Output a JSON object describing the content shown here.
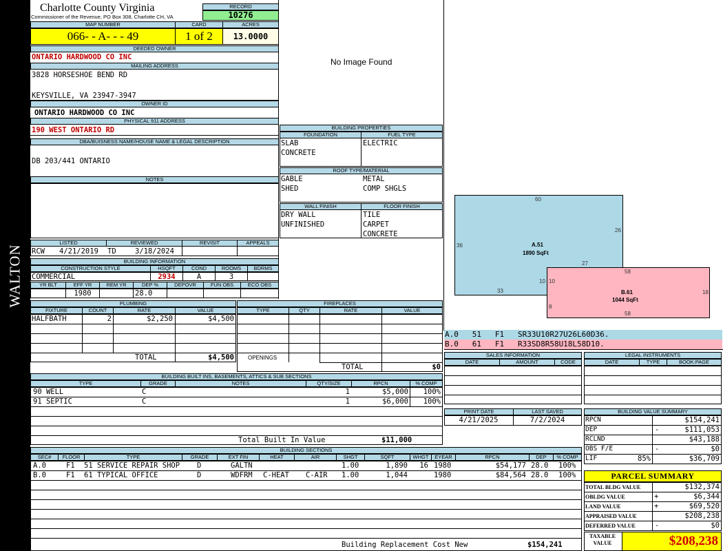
{
  "side_label": "WALTON",
  "header": {
    "county": "Charlotte County Virginia",
    "commissioner": "Commissioner of the Revenue, PO Box 308, Charlotte CH, VA",
    "record_label": "RECORD",
    "record": "10276",
    "map_label": "MAP NUMBER",
    "map_number": "066- - A- - - 49",
    "card_label": "CARD",
    "card": "1 of 2",
    "acres_label": "ACRES",
    "acres": "13.0000"
  },
  "owner": {
    "deeded_label": "DEEDED OWNER",
    "deeded": "ONTARIO HARDWOOD CO INC",
    "mailing_label": "MAILING ADDRESS",
    "mail1": "3828 HORSESHOE BEND RD",
    "mail2": "KEYSVILLE, VA 23947-3947",
    "ownerid_label": "OWNER ID",
    "ownerid": "ONTARIO HARDWOOD CO INC",
    "phys_label": "PHYSICAL 911 ADDRESS",
    "phys": "190 WEST ONTARIO RD",
    "dba_label": "DBA/BUISNESS NAME/HOUSE NAME & LEGAL DESCRIPTION",
    "dba": "DB 203/441 ONTARIO",
    "notes_label": "NOTES"
  },
  "image": {
    "text": "No Image Found"
  },
  "props": {
    "title": "BUILDING PROPERTIES",
    "foundation_label": "FOUNDATION",
    "foundation": [
      "SLAB",
      "CONCRETE"
    ],
    "fuel_label": "FUEL TYPE",
    "fuel": [
      "ELECTRIC"
    ],
    "roof_label": "ROOF TYPE/MATERIAL",
    "roof_left": [
      "GABLE",
      "SHED"
    ],
    "roof_right": [
      "METAL",
      "COMP SHGLS"
    ],
    "wall_label": "WALL FINISH",
    "wall": [
      "DRY WALL",
      "UNFINISHED"
    ],
    "floor_label": "FLOOR FINISH",
    "floor": [
      "TILE",
      "CARPET",
      "CONCRETE"
    ]
  },
  "review": {
    "listed_label": "LISTED",
    "listed_by": "RCW",
    "listed_date": "4/21/2019",
    "reviewed_label": "REVIEWED",
    "reviewed_by": "TD",
    "reviewed_date": "3/18/2024",
    "revisit_label": "REVISIT",
    "appeals_label": "APPEALS"
  },
  "bldg_info": {
    "title": "BUILDING INFORMATION",
    "style_label": "CONSTRUCTION STYLE",
    "style": "COMMERCIAL",
    "hsqft_label": "HSQFT",
    "hsqft": "2934",
    "cond_label": "COND",
    "cond": "A",
    "rooms_label": "ROOMS",
    "rooms": "3",
    "bdrms_label": "BDRMS",
    "yrblt_label": "YR BLT",
    "effyr_label": "EFF YR",
    "effyr": "1980",
    "remyr_label": "REM YR",
    "dep_label": "DEP %",
    "dep": "28.0",
    "depovr_label": "DEPOVR",
    "funobs_label": "FUN OBS",
    "ecoobs_label": "ECO OBS"
  },
  "plumbing": {
    "title": "PLUMBING",
    "cols": [
      "FIXTURE",
      "COUNT",
      "RATE",
      "VALUE"
    ],
    "rows": [
      {
        "fixture": "HALFBATH",
        "count": "2",
        "rate": "$2,250",
        "value": "$4,500"
      }
    ],
    "total_label": "TOTAL",
    "total": "$4,500"
  },
  "fireplaces": {
    "title": "FIREPLACES",
    "cols": [
      "TYPE",
      "QTY",
      "RATE",
      "VALUE"
    ],
    "openings_label": "OPENINGS",
    "total_label": "TOTAL",
    "total": "$0"
  },
  "builtins": {
    "title": "BUILDING BUILT INS, BASEMENTS, ATTICS & SUB SECTIONS",
    "cols": [
      "TYPE",
      "GRADE",
      "NOTES",
      "QTY/SIZE",
      "RPCN",
      "% COMP"
    ],
    "rows": [
      {
        "type": "90 WELL",
        "grade": "C",
        "qty": "1",
        "rpcn": "$5,000",
        "comp": "100%"
      },
      {
        "type": "91 SEPTIC",
        "grade": "C",
        "qty": "1",
        "rpcn": "$6,000",
        "comp": "100%"
      }
    ],
    "total_label": "Total Built In Value",
    "total": "$11,000"
  },
  "sections": {
    "title": "BUILDING SECTIONS",
    "cols": [
      "SEC#",
      "FLOOR",
      "TYPE",
      "GRADE",
      "EXT FIN",
      "HEAT",
      "AIR",
      "SHGT",
      "SQFT",
      "WHGT",
      "EYEAR",
      "RPCN",
      "DEP",
      "% COMP"
    ],
    "rows": [
      {
        "sec": "A.0",
        "floor": "F1",
        "type": "51 SERVICE REPAIR SHOP",
        "grade": "D",
        "ext": "GALTN",
        "heat": "",
        "air": "",
        "shgt": "1.00",
        "sqft": "1,890",
        "whgt": "16",
        "eyear": "1980",
        "rpcn": "$54,177",
        "dep": "28.0",
        "comp": "100%"
      },
      {
        "sec": "B.0",
        "floor": "F1",
        "type": "61 TYPICAL OFFICE",
        "grade": "D",
        "ext": "WDFRM",
        "heat": "C-HEAT",
        "air": "C-AIR",
        "shgt": "1.00",
        "sqft": "1,044",
        "whgt": "",
        "eyear": "1980",
        "rpcn": "$84,564",
        "dep": "28.0",
        "comp": "100%"
      }
    ],
    "total_label": "Building Replacement Cost New",
    "total": "$154,241"
  },
  "sketch": {
    "a_label": "A.51",
    "a_area": "1890 SqFt",
    "b_label": "B.61",
    "b_area": "1044 SqFt",
    "a_top": "60",
    "a_right": "26",
    "a_left": "36",
    "a_bottom": "33",
    "a_notch": "27",
    "a_step": "10",
    "b_top": "58",
    "b_right": "18",
    "b_left": "10",
    "b_bottom": "58",
    "b_leftlow": "8",
    "color_a": "#add8e6",
    "color_b": "#ffb6c1",
    "line_a": "A.0   51   F1   SR33U10R27U26L60D36.",
    "line_b": "B.0   61   F1   R33SD8R58U18L58D10."
  },
  "sales": {
    "title": "SALES INFORMATION",
    "cols": [
      "DATE",
      "AMOUNT",
      "CODE"
    ]
  },
  "legal": {
    "title": "LEGAL INSTRUMENTS",
    "cols": [
      "DATE",
      "TYPE",
      "BOOK:PAGE"
    ]
  },
  "dates": {
    "print_label": "PRINT DATE",
    "print": "4/21/2025",
    "saved_label": "LAST SAVED",
    "saved": "7/2/2024"
  },
  "value_summary": {
    "title": "BUILDING VALUE SUMMARY",
    "rows": [
      {
        "label": "RPCN",
        "sign": "",
        "value": "$154,241"
      },
      {
        "label": "DEP",
        "sign": "-",
        "value": "$111,053"
      },
      {
        "label": "RCLND",
        "sign": "",
        "value": "$43,188"
      },
      {
        "label": "OBS F/E",
        "sign": "-",
        "value": "$0"
      },
      {
        "label": "LIF",
        "pct": "85%",
        "sign": "",
        "value": "$36,709"
      }
    ]
  },
  "parcel": {
    "title": "PARCEL SUMMARY",
    "rows": [
      {
        "label": "TOTAL BLDG VALUE",
        "sign": "",
        "value": "$132,374"
      },
      {
        "label": "OBLDG VALUE",
        "sign": "+",
        "value": "$6,344"
      },
      {
        "label": "LAND VALUE",
        "sign": "+",
        "value": "$69,520"
      },
      {
        "label": "APPRAISED VALUE",
        "sign": "",
        "value": "$208,238"
      },
      {
        "label": "DEFERRED VALUE",
        "sign": "-",
        "value": "$0"
      }
    ],
    "taxable_label": "TAXABLE VALUE",
    "taxable": "$208,238"
  }
}
